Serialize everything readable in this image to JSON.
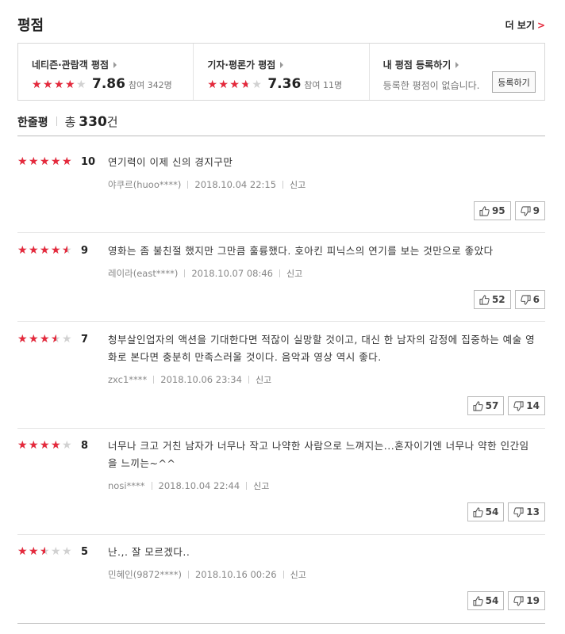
{
  "header": {
    "title": "평점",
    "more": "더 보기",
    "more_arrow": ">"
  },
  "scores": {
    "netizen": {
      "label": "네티즌·관람객 평점",
      "rating": 3.9,
      "score": "7.86",
      "count": "참여 342명"
    },
    "critic": {
      "label": "기자·평론가 평점",
      "rating": 3.6,
      "score": "7.36",
      "count": "참여 11명"
    },
    "mine": {
      "label": "내 평점 등록하기",
      "desc": "등록한 평점이 없습니다.",
      "button": "등록하기"
    }
  },
  "oneline": {
    "title": "한줄평",
    "total_label": "총",
    "count": "330",
    "unit": "건"
  },
  "reviews": [
    {
      "rating": 5,
      "score": "10",
      "text": "연기력이 이제 신의 경지구만",
      "user": "야쿠르(huoo****)",
      "date": "2018.10.04 22:15",
      "report": "신고",
      "likes": "95",
      "dislikes": "9"
    },
    {
      "rating": 4.5,
      "score": "9",
      "text": "영화는 좀 불친절 했지만 그만큼 훌륭했다. 호아킨 피닉스의 연기를 보는 것만으로 좋았다",
      "user": "레이라(east****)",
      "date": "2018.10.07 08:46",
      "report": "신고",
      "likes": "52",
      "dislikes": "6"
    },
    {
      "rating": 3.5,
      "score": "7",
      "text": "청부살인업자의 액션을 기대한다면 적잖이 실망할 것이고, 대신 한 남자의 감정에 집중하는 예술 영화로 본다면 충분히 만족스러울 것이다. 음악과 영상 역시 좋다.",
      "user": "zxc1****",
      "date": "2018.10.06 23:34",
      "report": "신고",
      "likes": "57",
      "dislikes": "14"
    },
    {
      "rating": 4,
      "score": "8",
      "text": "너무나 크고 거친 남자가 너무나 작고 나약한 사람으로 느껴지는...혼자이기엔 너무나 약한 인간임을 느끼는~^^",
      "user": "nosi****",
      "date": "2018.10.04 22:44",
      "report": "신고",
      "likes": "54",
      "dislikes": "13"
    },
    {
      "rating": 2.5,
      "score": "5",
      "text": "난.,. 잘 모르겠다..",
      "user": "민혜인(9872****)",
      "date": "2018.10.16 00:26",
      "report": "신고",
      "likes": "54",
      "dislikes": "19"
    }
  ],
  "colors": {
    "star_on": "#e5293c",
    "star_off": "#d1d1d1"
  }
}
